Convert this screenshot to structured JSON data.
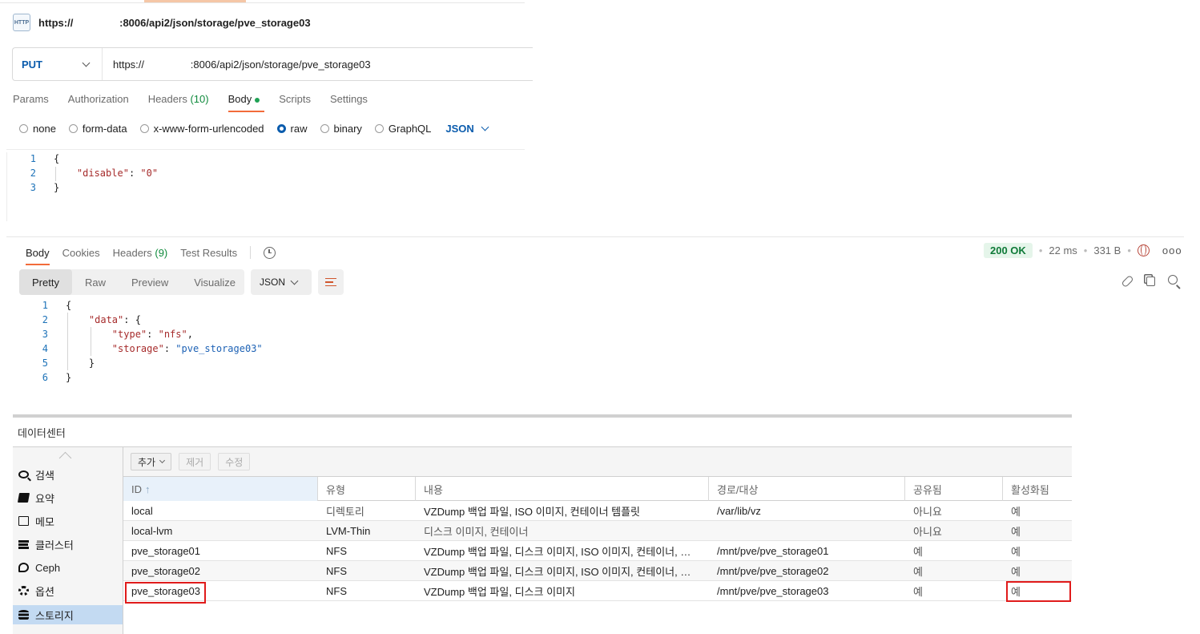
{
  "request": {
    "title_url": "https://                :8006/api2/json/storage/pve_storage03",
    "http_icon_label": "HTTP",
    "method": "PUT",
    "url": "https://                :8006/api2/json/storage/pve_storage03",
    "tabs": [
      {
        "label": "Params"
      },
      {
        "label": "Authorization"
      },
      {
        "label": "Headers",
        "count": "(10)"
      },
      {
        "label": "Body"
      },
      {
        "label": "Scripts"
      },
      {
        "label": "Settings"
      }
    ],
    "body_types": [
      "none",
      "form-data",
      "x-www-form-urlencoded",
      "raw",
      "binary",
      "GraphQL"
    ],
    "body_type_selected": "raw",
    "body_format": "JSON",
    "body_lines": [
      {
        "n": "1",
        "text": "{"
      },
      {
        "n": "2",
        "key": "\"disable\"",
        "sep": ": ",
        "val": "\"0\""
      },
      {
        "n": "3",
        "text": "}"
      }
    ]
  },
  "response": {
    "tabs": [
      {
        "label": "Body"
      },
      {
        "label": "Cookies"
      },
      {
        "label": "Headers",
        "count": "(9)"
      },
      {
        "label": "Test Results"
      }
    ],
    "status": "200 OK",
    "time": "22 ms",
    "size": "331 B",
    "views": [
      "Pretty",
      "Raw",
      "Preview",
      "Visualize"
    ],
    "view_selected": "Pretty",
    "format": "JSON",
    "lines": [
      {
        "n": "1",
        "text": "{"
      },
      {
        "n": "2",
        "key": "\"data\"",
        "sep": ": ",
        "tail": "{"
      },
      {
        "n": "3",
        "key": "\"type\"",
        "sep": ": ",
        "val": "\"nfs\"",
        "tail": ","
      },
      {
        "n": "4",
        "key": "\"storage\"",
        "sep": ": ",
        "val": "\"pve_storage03\""
      },
      {
        "n": "5",
        "text": "}"
      },
      {
        "n": "6",
        "text": "}"
      }
    ]
  },
  "pve": {
    "panel_title": "데이터센터",
    "sidebar": [
      {
        "label": "검색",
        "icon": "search-icon"
      },
      {
        "label": "요약",
        "icon": "book-icon"
      },
      {
        "label": "메모",
        "icon": "note-icon"
      },
      {
        "label": "클러스터",
        "icon": "server-icon"
      },
      {
        "label": "Ceph",
        "icon": "ceph-icon"
      },
      {
        "label": "옵션",
        "icon": "gear-icon"
      },
      {
        "label": "스토리지",
        "icon": "database-icon"
      }
    ],
    "sidebar_selected": "스토리지",
    "toolbar": {
      "add": "추가",
      "remove": "제거",
      "edit": "수정"
    },
    "columns": [
      "ID",
      "유형",
      "내용",
      "경로/대상",
      "공유됨",
      "활성화됨"
    ],
    "rows": [
      [
        "local",
        "디렉토리",
        "VZDump 백업 파일, ISO 이미지, 컨테이너 템플릿",
        "/var/lib/vz",
        "아니요",
        "예"
      ],
      [
        "local-lvm",
        "LVM-Thin",
        "디스크 이미지, 컨테이너",
        "",
        "아니요",
        "예"
      ],
      [
        "pve_storage01",
        "NFS",
        "VZDump 백업 파일, 디스크 이미지, ISO 이미지, 컨테이너, 스니펫",
        "/mnt/pve/pve_storage01",
        "예",
        "예"
      ],
      [
        "pve_storage02",
        "NFS",
        "VZDump 백업 파일, 디스크 이미지, ISO 이미지, 컨테이너, 스니펫",
        "/mnt/pve/pve_storage02",
        "예",
        "예"
      ],
      [
        "pve_storage03",
        "NFS",
        "VZDump 백업 파일, 디스크 이미지",
        "/mnt/pve/pve_storage03",
        "예",
        "예"
      ]
    ],
    "highlight_color": "#e01b1b"
  }
}
